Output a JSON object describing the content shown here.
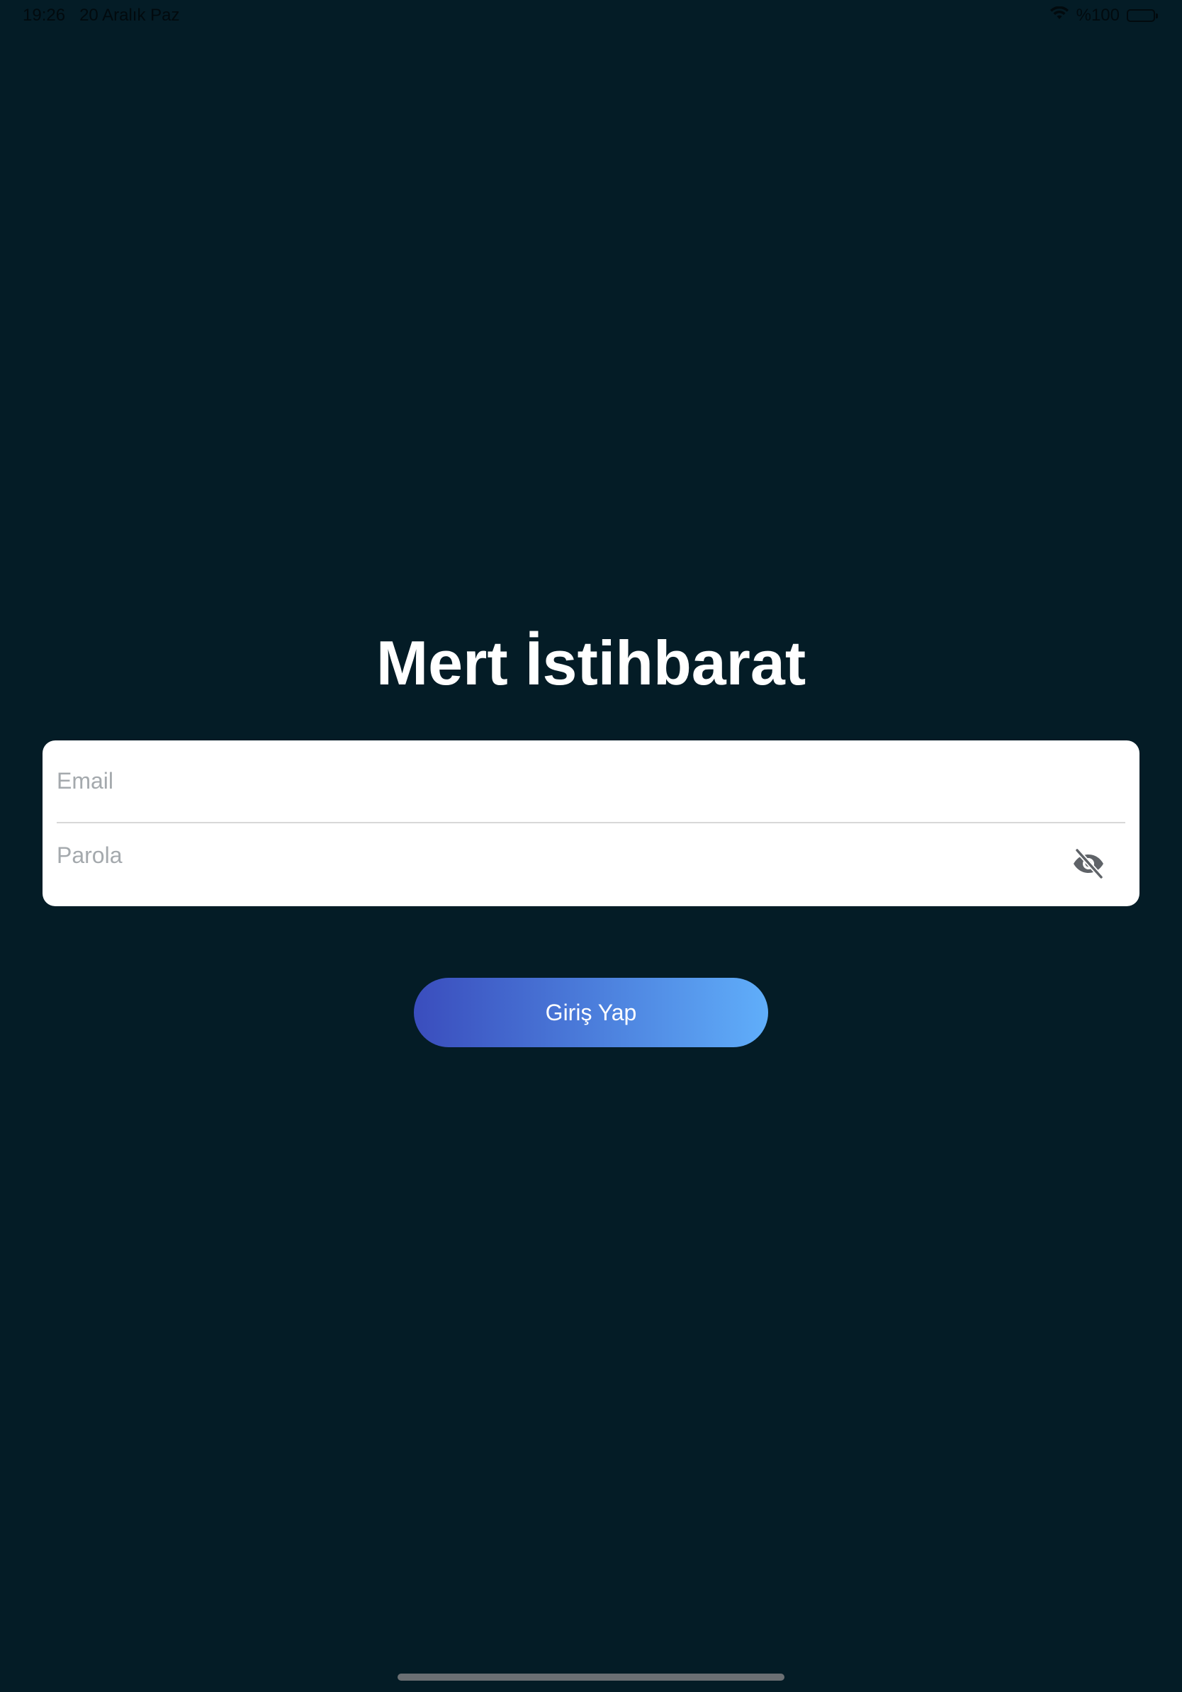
{
  "status_bar": {
    "time": "19:26",
    "date": "20 Aralık Paz",
    "battery_text": "%100",
    "battery_level": 1.0,
    "wifi_icon": "wifi-icon",
    "battery_icon": "battery-icon"
  },
  "app": {
    "title": "Mert İstihbarat"
  },
  "login_form": {
    "email_placeholder": "Email",
    "email_value": "",
    "password_placeholder": "Parola",
    "password_value": "",
    "visibility_icon": "eye-slash-icon",
    "submit_label": "Giriş Yap"
  },
  "colors": {
    "background": "#041c26",
    "card": "#ffffff",
    "placeholder": "#a4a9ad",
    "button_gradient_start": "#3a4dbd",
    "button_gradient_end": "#60aefa",
    "title": "#ffffff"
  }
}
